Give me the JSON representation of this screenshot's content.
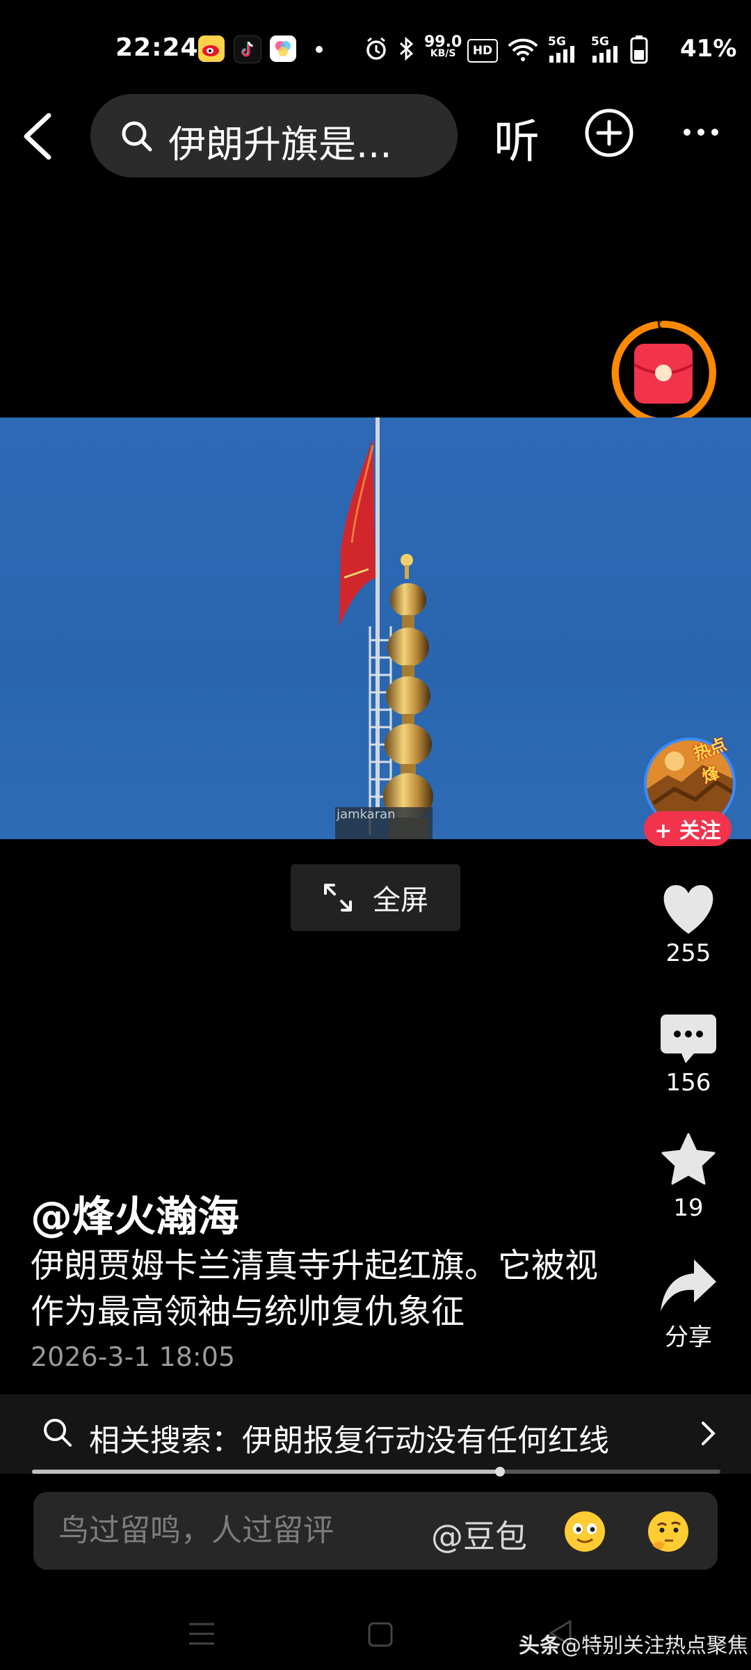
{
  "status_bar": {
    "time": "22:24",
    "apps": [
      "weibo-icon",
      "douyin-icon",
      "app-icon"
    ],
    "net_speed_value": "99.0",
    "net_speed_unit": "KB/S",
    "hd_badge": "HD",
    "signal1": "5G",
    "signal2": "5G",
    "battery": "41%"
  },
  "top_nav": {
    "search_text": "伊朗升旗是...",
    "listen_label": "听"
  },
  "video": {
    "watermark": "jamkaran"
  },
  "fullscreen_label": "全屏",
  "right_rail": {
    "avatar_badge": "热点烽",
    "follow_label": "+ 关注",
    "likes": "255",
    "comments": "156",
    "favorites": "19",
    "share_label": "分享"
  },
  "post": {
    "author": "@烽火瀚海",
    "description": "伊朗贾姆卡兰清真寺升起红旗。它被视作为最高领袖与统帅复仇象征",
    "date": "2026-3-1 18:05"
  },
  "related": {
    "prefix": "相关搜索：",
    "query": "伊朗报复行动没有任何红线",
    "progress": 0.68
  },
  "comment": {
    "placeholder": "鸟过留鸣，人过留评",
    "mention": "@豆包"
  },
  "footer_watermark": {
    "brand": "头条",
    "account": "@特别关注热点聚焦"
  },
  "colors": {
    "accent_red": "#f2334c",
    "ring_orange": "#ff8a00",
    "sky_blue": "#2d69b4"
  }
}
